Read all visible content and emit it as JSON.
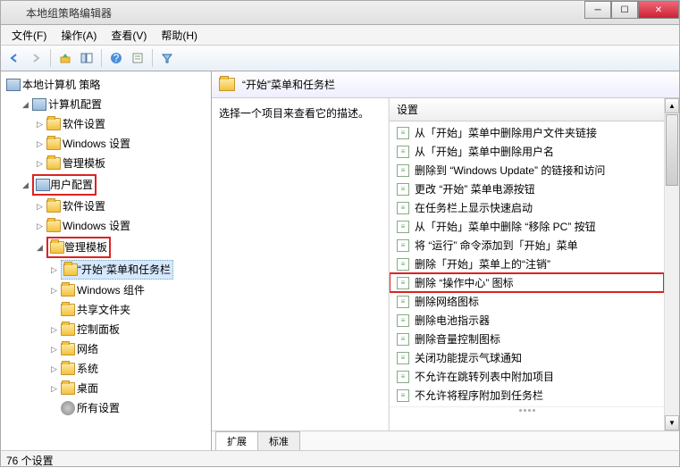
{
  "window": {
    "title": "本地组策略编辑器"
  },
  "menus": {
    "file": "文件(F)",
    "action": "操作(A)",
    "view": "查看(V)",
    "help": "帮助(H)"
  },
  "tree": {
    "root": "本地计算机 策略",
    "computer_config": "计算机配置",
    "cc_software": "软件设置",
    "cc_windows": "Windows 设置",
    "cc_admin": "管理模板",
    "user_config": "用户配置",
    "uc_software": "软件设置",
    "uc_windows": "Windows 设置",
    "uc_admin": "管理模板",
    "start_taskbar": "“开始”菜单和任务栏",
    "win_components": "Windows 组件",
    "shared_folders": "共享文件夹",
    "control_panel": "控制面板",
    "network": "网络",
    "system": "系统",
    "desktop": "桌面",
    "all_settings": "所有设置"
  },
  "right": {
    "header": "“开始”菜单和任务栏",
    "desc_prompt": "选择一个项目来查看它的描述。",
    "col_setting": "设置",
    "items": [
      "从「开始」菜单中删除用户文件夹链接",
      "从「开始」菜单中删除用户名",
      "删除到 “Windows Update” 的链接和访问",
      "更改 “开始” 菜单电源按钮",
      "在任务栏上显示快速启动",
      "从「开始」菜单中删除 “移除 PC” 按钮",
      "将 “运行” 命令添加到「开始」菜单",
      "删除「开始」菜单上的“注销”",
      "删除 “操作中心” 图标",
      "删除网络图标",
      "删除电池指示器",
      "删除音量控制图标",
      "关闭功能提示气球通知",
      "不允许在跳转列表中附加项目",
      "不允许将程序附加到任务栏"
    ],
    "highlight_index": 8
  },
  "tabs": {
    "extended": "扩展",
    "standard": "标准"
  },
  "status": "76 个设置"
}
